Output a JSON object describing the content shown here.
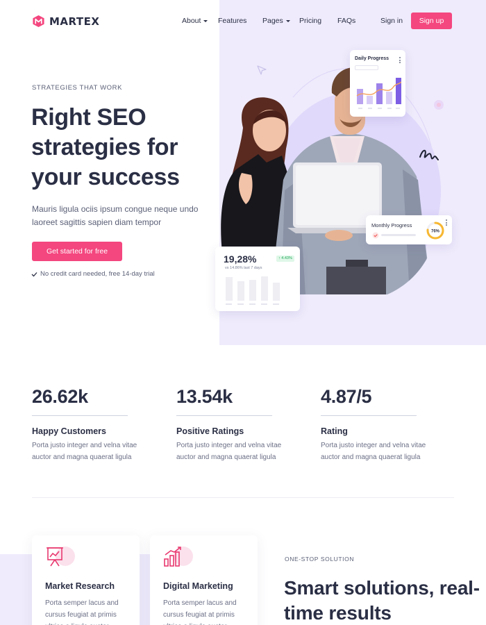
{
  "brand": {
    "name": "MARTEX",
    "accent": "#f4467f",
    "lavender": "#efebfc"
  },
  "nav": {
    "items": [
      {
        "label": "About",
        "has_caret": true
      },
      {
        "label": "Features",
        "has_caret": false
      },
      {
        "label": "Pages",
        "has_caret": true
      },
      {
        "label": "Pricing",
        "has_caret": false
      },
      {
        "label": "FAQs",
        "has_caret": false
      }
    ],
    "signin": "Sign in",
    "signup": "Sign up"
  },
  "hero": {
    "eyebrow": "STRATEGIES THAT WORK",
    "title": "Right SEO strategies for your success",
    "description": "Mauris ligula ociis ipsum congue neque undo laoreet sagittis sapien diam tempor",
    "cta": "Get started for free",
    "note": "No credit card needed, free 14-day trial"
  },
  "widgets": {
    "daily_progress": {
      "title": "Daily Progress"
    },
    "monthly_progress": {
      "title": "Monthly Progress",
      "percent": "76%",
      "percent_value": 76
    },
    "stat_card": {
      "value": "19,28%",
      "sub": "vs 14.86% last 7 days",
      "badge": "↑ 4.43%"
    }
  },
  "stats": [
    {
      "value": "26.62k",
      "label": "Happy Customers",
      "desc": "Porta justo integer and velna vitae auctor and magna quaerat ligula"
    },
    {
      "value": "13.54k",
      "label": "Positive Ratings",
      "desc": "Porta justo integer and velna vitae auctor and magna quaerat ligula"
    },
    {
      "value": "4.87/5",
      "label": "Rating",
      "desc": "Porta justo integer and velna vitae auctor and magna quaerat ligula"
    }
  ],
  "services": [
    {
      "icon": "presentation-chart-icon",
      "title": "Market Research",
      "desc": "Porta semper lacus and cursus feugiat at primis ultrice a ligula auctor"
    },
    {
      "icon": "growth-chart-icon",
      "title": "Digital Marketing",
      "desc": "Porta semper lacus and cursus feugiat at primis ultrice a ligula auctor"
    }
  ],
  "solutions": {
    "eyebrow": "ONE-STOP SOLUTION",
    "title": "Smart solutions, real-time results"
  }
}
